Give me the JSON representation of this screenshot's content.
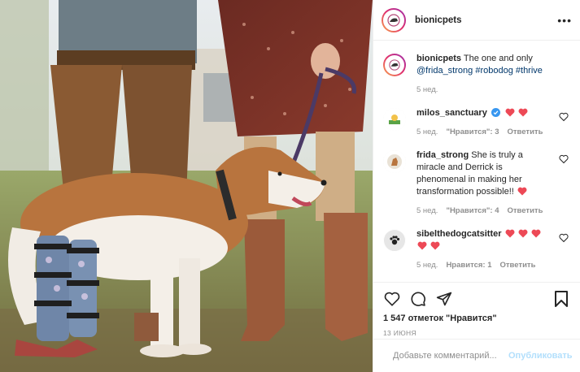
{
  "post": {
    "author": "bionicpets",
    "caption": {
      "user": "bionicpets",
      "text": " The one and only ",
      "mention": "@frida_strong",
      "tag1": "#robodog",
      "tag2": "#thrive",
      "time": "5 нед."
    }
  },
  "comments": [
    {
      "user": "milos_sanctuary",
      "text": "",
      "time": "5 нед.",
      "likes": "\"Нравится\": 3",
      "reply": "Ответить"
    },
    {
      "user": "frida_strong",
      "text": " She is truly a miracle and Derrick is phenomenal in making her transformation possible!!",
      "time": "5 нед.",
      "likes": "\"Нравится\": 4",
      "reply": "Ответить"
    },
    {
      "user": "sibelthedogcatsitter",
      "text": "",
      "time": "5 нед.",
      "likes": "Нравится: 1",
      "reply": "Ответить"
    }
  ],
  "actions": {
    "likes": "1 547 отметок \"Нравится\"",
    "date": "13 ИЮНЯ"
  },
  "comment_box": {
    "placeholder": "Добавьте комментарий...",
    "publish": "Опубликовать"
  },
  "colors": {
    "link": "#00376b",
    "heart_red": "#ed4956",
    "verified": "#3897f0",
    "publish_disabled": "#b2dffc"
  },
  "icons": [
    "more-icon",
    "heart-icon",
    "comment-icon",
    "share-icon",
    "bookmark-icon",
    "emoji-icon",
    "verified-icon"
  ]
}
